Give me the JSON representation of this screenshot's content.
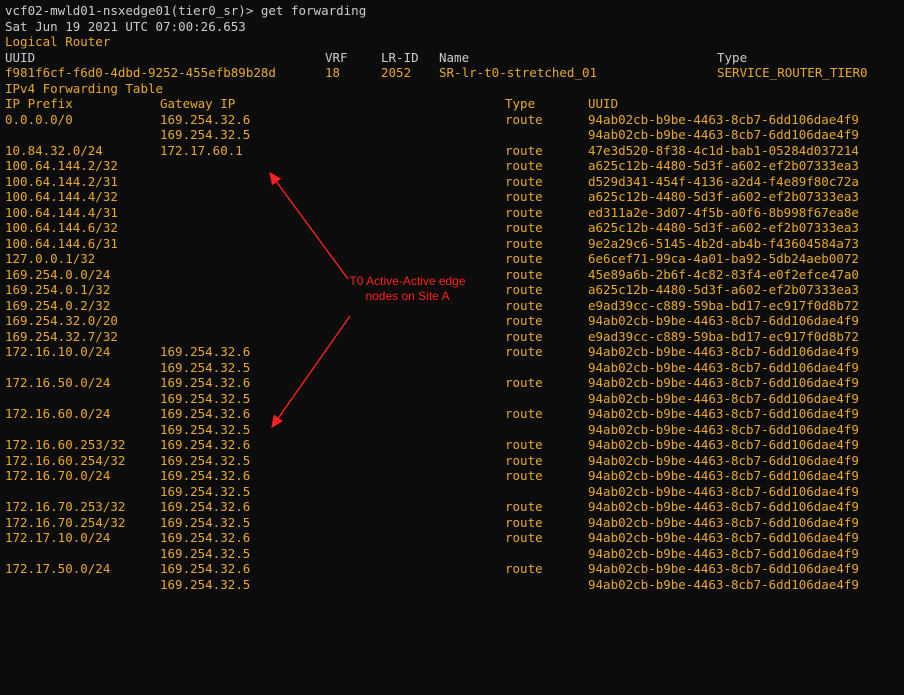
{
  "terminal": {
    "prompt_line": "vcf02-mwld01-nsxedge01(tier0_sr)> get forwarding",
    "timestamp": "Sat Jun 19 2021 UTC 07:00:26.653",
    "section_title": "Logical Router",
    "router_headers": {
      "uuid": "UUID",
      "vrf": "VRF",
      "lr_id": "LR-ID",
      "name": "Name",
      "type": "Type"
    },
    "router": {
      "uuid": "f981f6cf-f6d0-4dbd-9252-455efb89b28d",
      "vrf": "18",
      "lr_id": "2052",
      "name": "SR-lr-t0-stretched_01",
      "type": "SERVICE_ROUTER_TIER0"
    },
    "table_title": "IPv4 Forwarding Table",
    "table_headers": {
      "prefix": "IP Prefix",
      "gateway": "Gateway IP",
      "type": "Type",
      "uuid": "UUID"
    },
    "rows": [
      {
        "prefix": "0.0.0.0/0",
        "gateway": "169.254.32.6",
        "type": "route",
        "uuid": "94ab02cb-b9be-4463-8cb7-6dd106dae4f9"
      },
      {
        "prefix": "",
        "gateway": "169.254.32.5",
        "type": "",
        "uuid": "94ab02cb-b9be-4463-8cb7-6dd106dae4f9"
      },
      {
        "prefix": "10.84.32.0/24",
        "gateway": "172.17.60.1",
        "type": "route",
        "uuid": "47e3d520-8f38-4c1d-bab1-05284d037214"
      },
      {
        "prefix": "100.64.144.2/32",
        "gateway": "",
        "type": "route",
        "uuid": "a625c12b-4480-5d3f-a602-ef2b07333ea3"
      },
      {
        "prefix": "100.64.144.2/31",
        "gateway": "",
        "type": "route",
        "uuid": "d529d341-454f-4136-a2d4-f4e89f80c72a"
      },
      {
        "prefix": "100.64.144.4/32",
        "gateway": "",
        "type": "route",
        "uuid": "a625c12b-4480-5d3f-a602-ef2b07333ea3"
      },
      {
        "prefix": "100.64.144.4/31",
        "gateway": "",
        "type": "route",
        "uuid": "ed311a2e-3d07-4f5b-a0f6-8b998f67ea8e"
      },
      {
        "prefix": "100.64.144.6/32",
        "gateway": "",
        "type": "route",
        "uuid": "a625c12b-4480-5d3f-a602-ef2b07333ea3"
      },
      {
        "prefix": "100.64.144.6/31",
        "gateway": "",
        "type": "route",
        "uuid": "9e2a29c6-5145-4b2d-ab4b-f43604584a73"
      },
      {
        "prefix": "127.0.0.1/32",
        "gateway": "",
        "type": "route",
        "uuid": "6e6cef71-99ca-4a01-ba92-5db24aeb0072"
      },
      {
        "prefix": "169.254.0.0/24",
        "gateway": "",
        "type": "route",
        "uuid": "45e89a6b-2b6f-4c82-83f4-e0f2efce47a0"
      },
      {
        "prefix": "169.254.0.1/32",
        "gateway": "",
        "type": "route",
        "uuid": "a625c12b-4480-5d3f-a602-ef2b07333ea3"
      },
      {
        "prefix": "169.254.0.2/32",
        "gateway": "",
        "type": "route",
        "uuid": "e9ad39cc-c889-59ba-bd17-ec917f0d8b72"
      },
      {
        "prefix": "169.254.32.0/20",
        "gateway": "",
        "type": "route",
        "uuid": "94ab02cb-b9be-4463-8cb7-6dd106dae4f9"
      },
      {
        "prefix": "169.254.32.7/32",
        "gateway": "",
        "type": "route",
        "uuid": "e9ad39cc-c889-59ba-bd17-ec917f0d8b72"
      },
      {
        "prefix": "172.16.10.0/24",
        "gateway": "169.254.32.6",
        "type": "route",
        "uuid": "94ab02cb-b9be-4463-8cb7-6dd106dae4f9"
      },
      {
        "prefix": "",
        "gateway": "169.254.32.5",
        "type": "",
        "uuid": "94ab02cb-b9be-4463-8cb7-6dd106dae4f9"
      },
      {
        "prefix": "172.16.50.0/24",
        "gateway": "169.254.32.6",
        "type": "route",
        "uuid": "94ab02cb-b9be-4463-8cb7-6dd106dae4f9"
      },
      {
        "prefix": "",
        "gateway": "169.254.32.5",
        "type": "",
        "uuid": "94ab02cb-b9be-4463-8cb7-6dd106dae4f9"
      },
      {
        "prefix": "172.16.60.0/24",
        "gateway": "169.254.32.6",
        "type": "route",
        "uuid": "94ab02cb-b9be-4463-8cb7-6dd106dae4f9"
      },
      {
        "prefix": "",
        "gateway": "169.254.32.5",
        "type": "",
        "uuid": "94ab02cb-b9be-4463-8cb7-6dd106dae4f9"
      },
      {
        "prefix": "172.16.60.253/32",
        "gateway": "169.254.32.6",
        "type": "route",
        "uuid": "94ab02cb-b9be-4463-8cb7-6dd106dae4f9"
      },
      {
        "prefix": "172.16.60.254/32",
        "gateway": "169.254.32.5",
        "type": "route",
        "uuid": "94ab02cb-b9be-4463-8cb7-6dd106dae4f9"
      },
      {
        "prefix": "172.16.70.0/24",
        "gateway": "169.254.32.6",
        "type": "route",
        "uuid": "94ab02cb-b9be-4463-8cb7-6dd106dae4f9"
      },
      {
        "prefix": "",
        "gateway": "169.254.32.5",
        "type": "",
        "uuid": "94ab02cb-b9be-4463-8cb7-6dd106dae4f9"
      },
      {
        "prefix": "172.16.70.253/32",
        "gateway": "169.254.32.6",
        "type": "route",
        "uuid": "94ab02cb-b9be-4463-8cb7-6dd106dae4f9"
      },
      {
        "prefix": "172.16.70.254/32",
        "gateway": "169.254.32.5",
        "type": "route",
        "uuid": "94ab02cb-b9be-4463-8cb7-6dd106dae4f9"
      },
      {
        "prefix": "172.17.10.0/24",
        "gateway": "169.254.32.6",
        "type": "route",
        "uuid": "94ab02cb-b9be-4463-8cb7-6dd106dae4f9"
      },
      {
        "prefix": "",
        "gateway": "169.254.32.5",
        "type": "",
        "uuid": "94ab02cb-b9be-4463-8cb7-6dd106dae4f9"
      },
      {
        "prefix": "172.17.50.0/24",
        "gateway": "169.254.32.6",
        "type": "route",
        "uuid": "94ab02cb-b9be-4463-8cb7-6dd106dae4f9"
      },
      {
        "prefix": "",
        "gateway": "169.254.32.5",
        "type": "",
        "uuid": "94ab02cb-b9be-4463-8cb7-6dd106dae4f9"
      }
    ]
  },
  "annotation": {
    "line1": "T0 Active-Active edge",
    "line2": "nodes on Site A"
  },
  "colors": {
    "background": "#0c0c0c",
    "text_primary": "#cccccc",
    "text_accent": "#e8a82a",
    "annotation": "#ff2020"
  }
}
